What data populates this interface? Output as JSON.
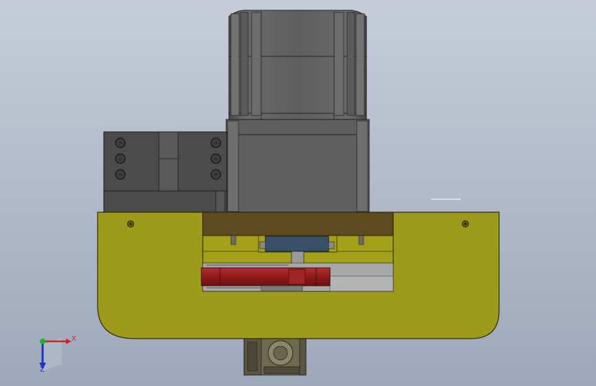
{
  "scene": {
    "view": "front",
    "background": [
      "#c6cdd9",
      "#9ea8ba"
    ]
  },
  "triad": {
    "x_label": "X",
    "z_label": "Z",
    "x_color": "#d42020",
    "y_color": "#20b020",
    "z_color": "#2030c8"
  },
  "parts": {
    "base_plate_color": "#9e9a1c",
    "rail_color": "#a5a01a",
    "beam_color": "#5e4a1e",
    "motor_color": "#5c5c5c",
    "gear_color": "#9b1f1f",
    "bracket_color": "#4c4c4c",
    "block_color": "#3a4f68"
  }
}
